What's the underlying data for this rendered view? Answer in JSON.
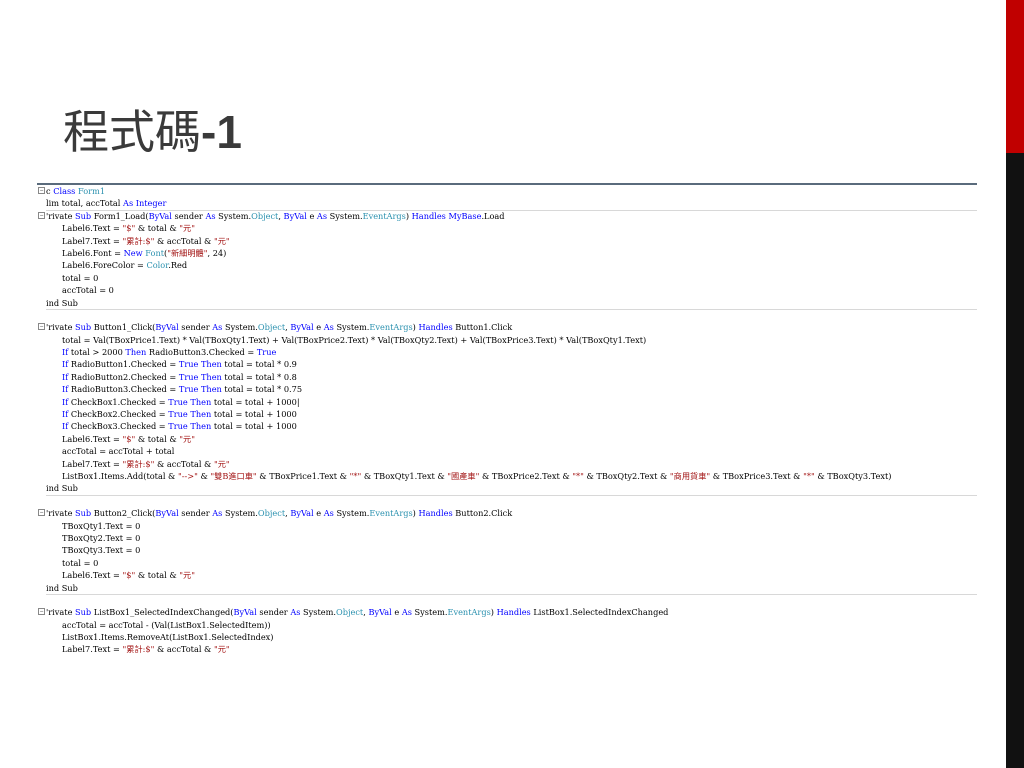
{
  "slide": {
    "title_text": "程式碼",
    "title_num": "-1",
    "colors": {
      "accent_red": "#c00000",
      "accent_black": "#111111",
      "rule": "#5a6b7c"
    }
  },
  "code": {
    "lines": [
      {
        "t": [
          [
            "",
            "c "
          ],
          [
            "kw",
            "Class"
          ],
          [
            "",
            " "
          ],
          [
            "ty",
            "Form1"
          ]
        ],
        "fold": true,
        "indent": false,
        "hr": false
      },
      {
        "t": [
          [
            "",
            "lim total, accTotal "
          ],
          [
            "kw",
            "As Integer"
          ]
        ],
        "fold": false,
        "indent": false,
        "hr": false
      },
      {
        "t": [
          [
            "",
            "'rivate "
          ],
          [
            "kw",
            "Sub"
          ],
          [
            "",
            " Form1_Load("
          ],
          [
            "kw",
            "ByVal"
          ],
          [
            "",
            " sender "
          ],
          [
            "kw",
            "As"
          ],
          [
            "",
            " System."
          ],
          [
            "ty",
            "Object"
          ],
          [
            "",
            ", "
          ],
          [
            "kw",
            "ByVal"
          ],
          [
            "",
            " e "
          ],
          [
            "kw",
            "As"
          ],
          [
            "",
            " System."
          ],
          [
            "ty",
            "EventArgs"
          ],
          [
            "",
            ") "
          ],
          [
            "kw",
            "Handles"
          ],
          [
            "",
            " "
          ],
          [
            "kw",
            "MyBase"
          ],
          [
            "",
            ".Load"
          ]
        ],
        "fold": true,
        "indent": false,
        "hr": true
      },
      {
        "t": [
          [
            "",
            "Label6.Text = "
          ],
          [
            "st",
            "\"$\""
          ],
          [
            "",
            " & total & "
          ],
          [
            "st",
            "\"元\""
          ]
        ],
        "fold": false,
        "indent": true,
        "hr": false
      },
      {
        "t": [
          [
            "",
            "Label7.Text = "
          ],
          [
            "st",
            "\"累計:$\""
          ],
          [
            "",
            " & accTotal & "
          ],
          [
            "st",
            "\"元\""
          ]
        ],
        "fold": false,
        "indent": true,
        "hr": false
      },
      {
        "t": [
          [
            "",
            "Label6.Font = "
          ],
          [
            "kw",
            "New"
          ],
          [
            "",
            " "
          ],
          [
            "ty",
            "Font"
          ],
          [
            "",
            "("
          ],
          [
            "st",
            "\"新細明體\""
          ],
          [
            "",
            ", 24)"
          ]
        ],
        "fold": false,
        "indent": true,
        "hr": false
      },
      {
        "t": [
          [
            "",
            "Label6.ForeColor = "
          ],
          [
            "ty",
            "Color"
          ],
          [
            "",
            ".Red"
          ]
        ],
        "fold": false,
        "indent": true,
        "hr": false
      },
      {
        "t": [
          [
            "",
            "total = 0"
          ]
        ],
        "fold": false,
        "indent": true,
        "hr": false
      },
      {
        "t": [
          [
            "",
            "accTotal = 0"
          ]
        ],
        "fold": false,
        "indent": true,
        "hr": false
      },
      {
        "t": [
          [
            "",
            "ind Sub"
          ]
        ],
        "fold": false,
        "indent": false,
        "hr": false
      },
      {
        "t": [
          [
            "",
            ""
          ]
        ],
        "fold": false,
        "indent": false,
        "hr": true
      },
      {
        "t": [
          [
            "",
            "'rivate "
          ],
          [
            "kw",
            "Sub"
          ],
          [
            "",
            " Button1_Click("
          ],
          [
            "kw",
            "ByVal"
          ],
          [
            "",
            " sender "
          ],
          [
            "kw",
            "As"
          ],
          [
            "",
            " System."
          ],
          [
            "ty",
            "Object"
          ],
          [
            "",
            ", "
          ],
          [
            "kw",
            "ByVal"
          ],
          [
            "",
            " e "
          ],
          [
            "kw",
            "As"
          ],
          [
            "",
            " System."
          ],
          [
            "ty",
            "EventArgs"
          ],
          [
            "",
            ") "
          ],
          [
            "kw",
            "Handles"
          ],
          [
            "",
            " Button1.Click"
          ]
        ],
        "fold": true,
        "indent": false,
        "hr": false
      },
      {
        "t": [
          [
            "",
            "total = Val(TBoxPrice1.Text) * Val(TBoxQty1.Text) + Val(TBoxPrice2.Text) * Val(TBoxQty2.Text) + Val(TBoxPrice3.Text) * Val(TBoxQty1.Text)"
          ]
        ],
        "fold": false,
        "indent": true,
        "hr": false
      },
      {
        "t": [
          [
            "kw",
            "If"
          ],
          [
            "",
            " total > 2000 "
          ],
          [
            "kw",
            "Then"
          ],
          [
            "",
            " RadioButton3.Checked = "
          ],
          [
            "kw",
            "True"
          ]
        ],
        "fold": false,
        "indent": true,
        "hr": false
      },
      {
        "t": [
          [
            "kw",
            "If"
          ],
          [
            "",
            " RadioButton1.Checked = "
          ],
          [
            "kw",
            "True"
          ],
          [
            "",
            " "
          ],
          [
            "kw",
            "Then"
          ],
          [
            "",
            " total = total * 0.9"
          ]
        ],
        "fold": false,
        "indent": true,
        "hr": false
      },
      {
        "t": [
          [
            "kw",
            "If"
          ],
          [
            "",
            " RadioButton2.Checked = "
          ],
          [
            "kw",
            "True"
          ],
          [
            "",
            " "
          ],
          [
            "kw",
            "Then"
          ],
          [
            "",
            " total = total * 0.8"
          ]
        ],
        "fold": false,
        "indent": true,
        "hr": false
      },
      {
        "t": [
          [
            "kw",
            "If"
          ],
          [
            "",
            " RadioButton3.Checked = "
          ],
          [
            "kw",
            "True"
          ],
          [
            "",
            " "
          ],
          [
            "kw",
            "Then"
          ],
          [
            "",
            " total = total * 0.75"
          ]
        ],
        "fold": false,
        "indent": true,
        "hr": false
      },
      {
        "t": [
          [
            "kw",
            "If"
          ],
          [
            "",
            " CheckBox1.Checked = "
          ],
          [
            "kw",
            "True"
          ],
          [
            "",
            " "
          ],
          [
            "kw",
            "Then"
          ],
          [
            "",
            " total = total + 1000|"
          ]
        ],
        "fold": false,
        "indent": true,
        "hr": false
      },
      {
        "t": [
          [
            "kw",
            "If"
          ],
          [
            "",
            " CheckBox2.Checked = "
          ],
          [
            "kw",
            "True"
          ],
          [
            "",
            " "
          ],
          [
            "kw",
            "Then"
          ],
          [
            "",
            " total = total + 1000"
          ]
        ],
        "fold": false,
        "indent": true,
        "hr": false
      },
      {
        "t": [
          [
            "kw",
            "If"
          ],
          [
            "",
            " CheckBox3.Checked = "
          ],
          [
            "kw",
            "True"
          ],
          [
            "",
            " "
          ],
          [
            "kw",
            "Then"
          ],
          [
            "",
            " total = total + 1000"
          ]
        ],
        "fold": false,
        "indent": true,
        "hr": false
      },
      {
        "t": [
          [
            "",
            "Label6.Text = "
          ],
          [
            "st",
            "\"$\""
          ],
          [
            "",
            " & total & "
          ],
          [
            "st",
            "\"元\""
          ]
        ],
        "fold": false,
        "indent": true,
        "hr": false
      },
      {
        "t": [
          [
            "",
            "accTotal = accTotal + total"
          ]
        ],
        "fold": false,
        "indent": true,
        "hr": false
      },
      {
        "t": [
          [
            "",
            "Label7.Text = "
          ],
          [
            "st",
            "\"累計:$\""
          ],
          [
            "",
            " & accTotal & "
          ],
          [
            "st",
            "\"元\""
          ]
        ],
        "fold": false,
        "indent": true,
        "hr": false
      },
      {
        "t": [
          [
            "",
            "ListBox1.Items.Add(total & "
          ],
          [
            "st",
            "\"-->\""
          ],
          [
            "",
            " & "
          ],
          [
            "st",
            "\"雙B進口車\""
          ],
          [
            "",
            " & TBoxPrice1.Text & "
          ],
          [
            "st",
            "\"*\""
          ],
          [
            "",
            " & TBoxQty1.Text & "
          ],
          [
            "st",
            "\"國產車\""
          ],
          [
            "",
            " & TBoxPrice2.Text & "
          ],
          [
            "st",
            "\"*\""
          ],
          [
            "",
            " & TBoxQty2.Text & "
          ],
          [
            "st",
            "\"商用貨車\""
          ],
          [
            "",
            " & TBoxPrice3.Text & "
          ],
          [
            "st",
            "\"*\""
          ],
          [
            "",
            " & TBoxQty3.Text)"
          ]
        ],
        "fold": false,
        "indent": true,
        "hr": false
      },
      {
        "t": [
          [
            "",
            "ind Sub"
          ]
        ],
        "fold": false,
        "indent": false,
        "hr": false
      },
      {
        "t": [
          [
            "",
            ""
          ]
        ],
        "fold": false,
        "indent": false,
        "hr": true
      },
      {
        "t": [
          [
            "",
            "'rivate "
          ],
          [
            "kw",
            "Sub"
          ],
          [
            "",
            " Button2_Click("
          ],
          [
            "kw",
            "ByVal"
          ],
          [
            "",
            " sender "
          ],
          [
            "kw",
            "As"
          ],
          [
            "",
            " System."
          ],
          [
            "ty",
            "Object"
          ],
          [
            "",
            ", "
          ],
          [
            "kw",
            "ByVal"
          ],
          [
            "",
            " e "
          ],
          [
            "kw",
            "As"
          ],
          [
            "",
            " System."
          ],
          [
            "ty",
            "EventArgs"
          ],
          [
            "",
            ") "
          ],
          [
            "kw",
            "Handles"
          ],
          [
            "",
            " Button2.Click"
          ]
        ],
        "fold": true,
        "indent": false,
        "hr": false
      },
      {
        "t": [
          [
            "",
            "TBoxQty1.Text = 0"
          ]
        ],
        "fold": false,
        "indent": true,
        "hr": false
      },
      {
        "t": [
          [
            "",
            "TBoxQty2.Text = 0"
          ]
        ],
        "fold": false,
        "indent": true,
        "hr": false
      },
      {
        "t": [
          [
            "",
            "TBoxQty3.Text = 0"
          ]
        ],
        "fold": false,
        "indent": true,
        "hr": false
      },
      {
        "t": [
          [
            "",
            "total = 0"
          ]
        ],
        "fold": false,
        "indent": true,
        "hr": false
      },
      {
        "t": [
          [
            "",
            "Label6.Text = "
          ],
          [
            "st",
            "\"$\""
          ],
          [
            "",
            " & total & "
          ],
          [
            "st",
            "\"元\""
          ]
        ],
        "fold": false,
        "indent": true,
        "hr": false
      },
      {
        "t": [
          [
            "",
            "ind Sub"
          ]
        ],
        "fold": false,
        "indent": false,
        "hr": false
      },
      {
        "t": [
          [
            "",
            ""
          ]
        ],
        "fold": false,
        "indent": false,
        "hr": true
      },
      {
        "t": [
          [
            "",
            "'rivate "
          ],
          [
            "kw",
            "Sub"
          ],
          [
            "",
            " ListBox1_SelectedIndexChanged("
          ],
          [
            "kw",
            "ByVal"
          ],
          [
            "",
            " sender "
          ],
          [
            "kw",
            "As"
          ],
          [
            "",
            " System."
          ],
          [
            "ty",
            "Object"
          ],
          [
            "",
            ", "
          ],
          [
            "kw",
            "ByVal"
          ],
          [
            "",
            " e "
          ],
          [
            "kw",
            "As"
          ],
          [
            "",
            " System."
          ],
          [
            "ty",
            "EventArgs"
          ],
          [
            "",
            ") "
          ],
          [
            "kw",
            "Handles"
          ],
          [
            "",
            " ListBox1.SelectedIndexChanged"
          ]
        ],
        "fold": true,
        "indent": false,
        "hr": false
      },
      {
        "t": [
          [
            "",
            "accTotal = accTotal - (Val(ListBox1.SelectedItem))"
          ]
        ],
        "fold": false,
        "indent": true,
        "hr": false
      },
      {
        "t": [
          [
            "",
            "ListBox1.Items.RemoveAt(ListBox1.SelectedIndex)"
          ]
        ],
        "fold": false,
        "indent": true,
        "hr": false
      },
      {
        "t": [
          [
            "",
            "Label7.Text = "
          ],
          [
            "st",
            "\"累計:$\""
          ],
          [
            "",
            " & accTotal & "
          ],
          [
            "st",
            "\"元\""
          ]
        ],
        "fold": false,
        "indent": true,
        "hr": false
      }
    ]
  }
}
